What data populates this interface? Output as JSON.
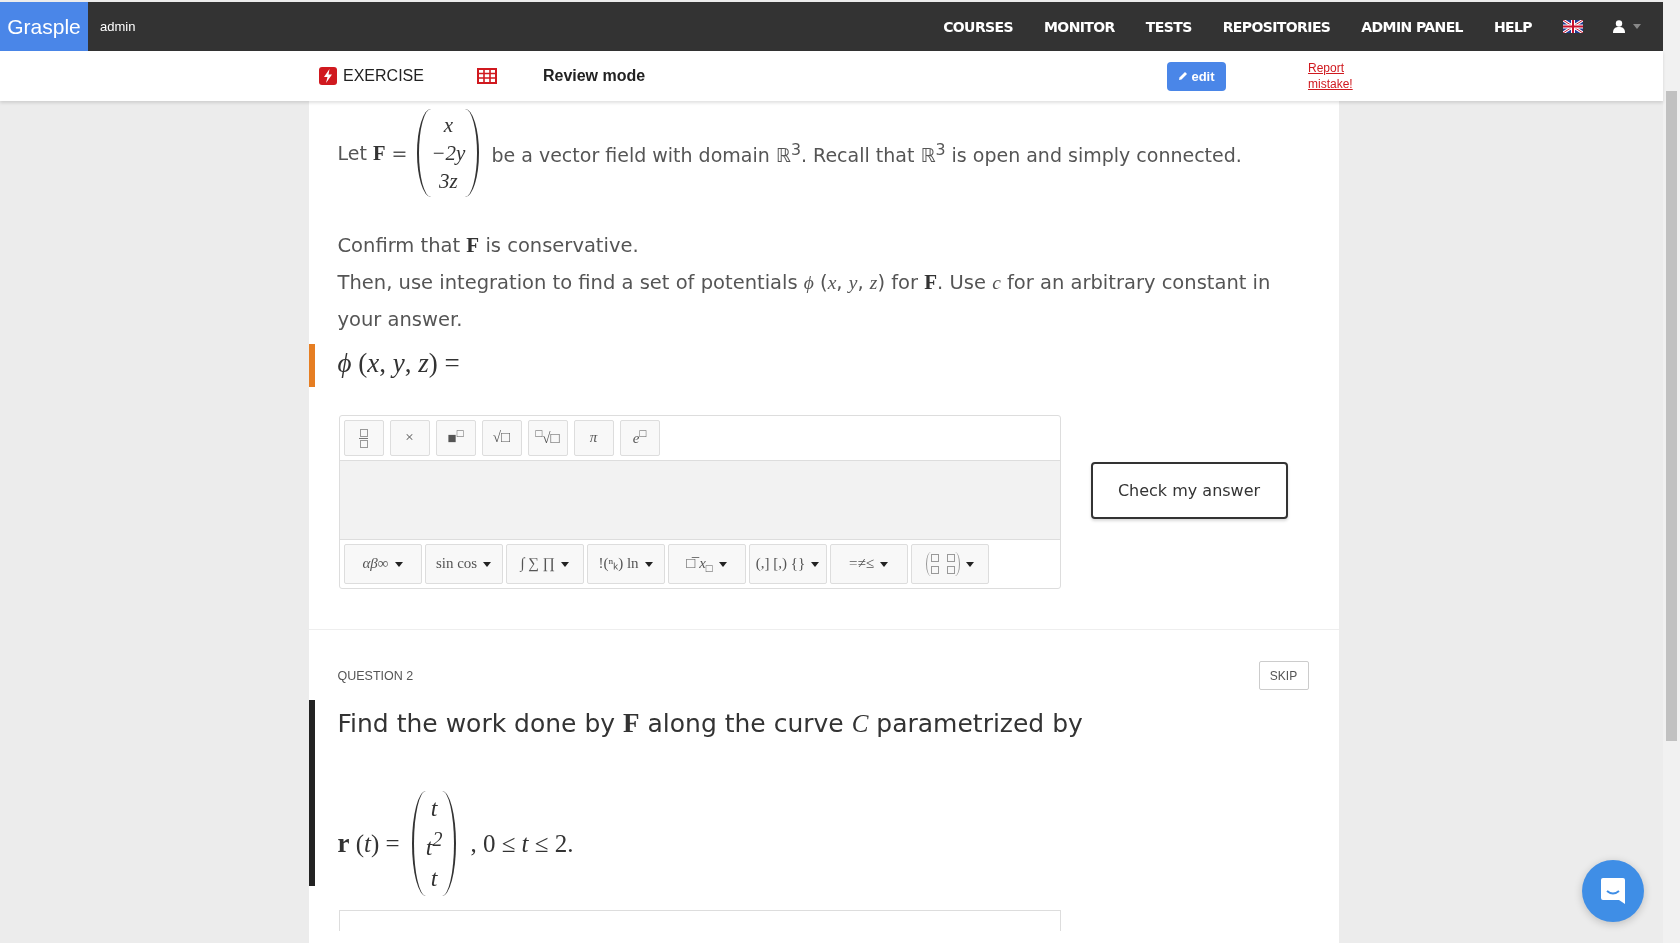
{
  "header": {
    "logo": "Grasple",
    "user": "admin",
    "nav": [
      {
        "label": "COURSES"
      },
      {
        "label": "MONITOR"
      },
      {
        "label": "TESTS"
      },
      {
        "label": "REPOSITORIES"
      },
      {
        "label": "ADMIN PANEL"
      },
      {
        "label": "HELP"
      }
    ]
  },
  "subbar": {
    "exercise": "EXERCISE",
    "review": "Review mode",
    "edit": "edit",
    "report": "Report mistake!"
  },
  "question1": {
    "intro_before": "Let **F** =",
    "vector": [
      "x",
      "−2y",
      "3z"
    ],
    "intro_after": "be a vector field with domain ℝ$^{3}$. Recall that ℝ$^{3}$ is open and simply connected.",
    "paragraphs": [
      "Confirm that **F** is conservative.",
      "Then, use integration to find a set of potentials *ϕ* (*x*, *y*, *z*) for **F**. Use *c* for an arbitrary constant in your answer."
    ],
    "answer_label": "*ϕ* (*x*, *y*, *z*) =",
    "toolbar_top": [
      {
        "kind": "fraction"
      },
      {
        "kind": "text",
        "label": "×"
      },
      {
        "kind": "text",
        "label": "■$^{□}$"
      },
      {
        "kind": "text",
        "label": "√□"
      },
      {
        "kind": "text",
        "label": "$^{□}$√□"
      },
      {
        "kind": "text",
        "label": "*π*"
      },
      {
        "kind": "text",
        "label": "*e*$^{□}$"
      }
    ],
    "toolbar_bottom": [
      {
        "kind": "text",
        "label": "*αβ*∞"
      },
      {
        "kind": "text",
        "label": "sin cos"
      },
      {
        "kind": "text",
        "label": "∫ ∑ ∏"
      },
      {
        "kind": "text",
        "label": "!(ⁿₖ) ln"
      },
      {
        "kind": "text",
        "label": "□̅ *x*$_{□}$"
      },
      {
        "kind": "text",
        "label": "(,] [,) {}"
      },
      {
        "kind": "text",
        "label": "=≠≤"
      },
      {
        "kind": "matrix"
      }
    ],
    "check": "Check my answer"
  },
  "question2": {
    "number": "QUESTION 2",
    "skip": "SKIP",
    "heading": "Find the work done by **F** along the curve *C* parametrized by",
    "formula_before": "**r** (*t*) =",
    "vector": [
      "t",
      "t$^{2}$",
      "t"
    ],
    "formula_after": ", 0 ≤ *t* ≤ 2."
  }
}
